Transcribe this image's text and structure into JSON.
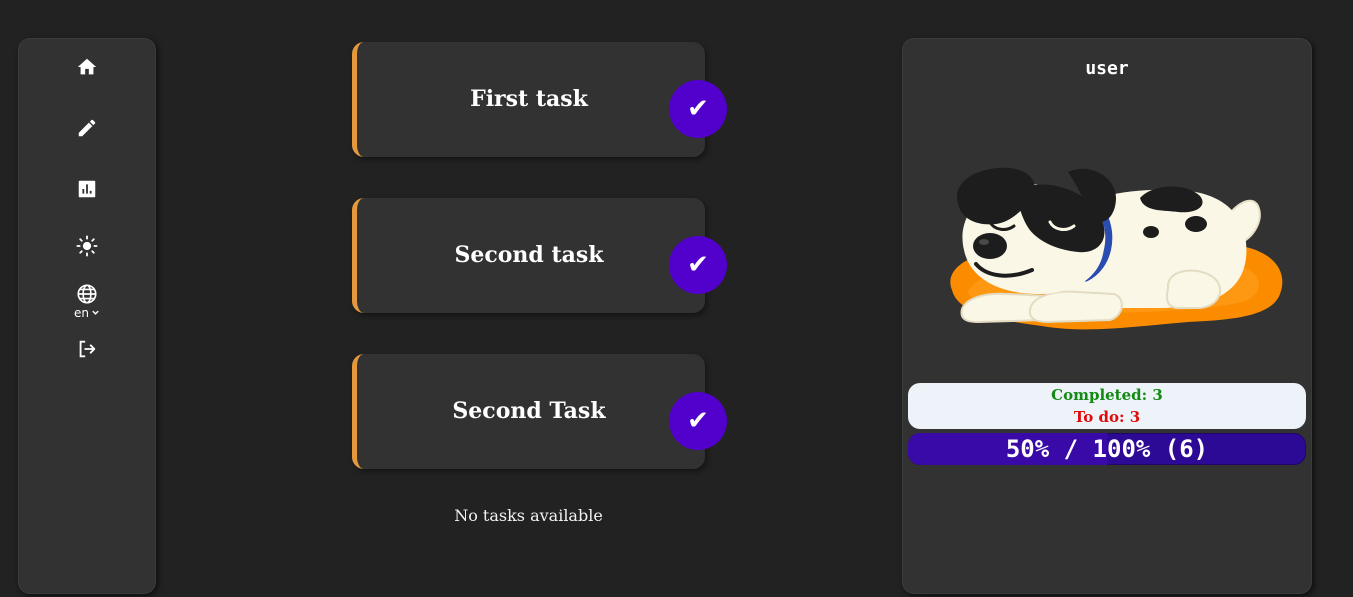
{
  "sidebar": {
    "items": [
      {
        "name": "home",
        "icon": "home-icon"
      },
      {
        "name": "edit",
        "icon": "pencil-icon"
      },
      {
        "name": "stats",
        "icon": "chart-icon"
      },
      {
        "name": "theme",
        "icon": "sun-icon"
      },
      {
        "name": "language",
        "icon": "globe-icon",
        "value": "en"
      },
      {
        "name": "logout",
        "icon": "logout-icon"
      }
    ]
  },
  "tasks": [
    {
      "title": "First task",
      "done_icon": "✔"
    },
    {
      "title": "Second task",
      "done_icon": "✔"
    },
    {
      "title": "Second Task",
      "done_icon": "✔"
    }
  ],
  "empty_message": "No tasks available",
  "profile": {
    "username": "user",
    "avatar": "sleeping-dog-illustration",
    "completed_label": "Completed: 3",
    "todo_label": "To do: 3",
    "progress_text": "50% / 100% (6)",
    "progress_percent": 50
  },
  "colors": {
    "accent": "#e5993d",
    "check": "#5200cc",
    "completed": "#138a13",
    "todo": "#e00b0b",
    "progress": "#2d0a96"
  }
}
